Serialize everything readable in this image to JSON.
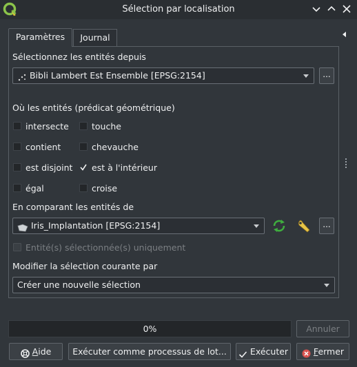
{
  "window": {
    "title": "Sélection par localisation"
  },
  "tabs": [
    {
      "label": "Paramètres",
      "active": true
    },
    {
      "label": "Journal",
      "active": false
    }
  ],
  "source": {
    "label": "Sélectionnez les entités depuis",
    "layer": "Bibli Lambert Est Ensemble [EPSG:2154]",
    "more_label": "..."
  },
  "predicates": {
    "label": "Où les entités (prédicat géométrique)",
    "items": [
      {
        "label": "intersecte",
        "checked": false
      },
      {
        "label": "touche",
        "checked": false
      },
      {
        "label": "contient",
        "checked": false
      },
      {
        "label": "chevauche",
        "checked": false
      },
      {
        "label": "est disjoint",
        "checked": false
      },
      {
        "label": "est à l'intérieur",
        "checked": true
      },
      {
        "label": "égal",
        "checked": false
      },
      {
        "label": "croise",
        "checked": false
      }
    ]
  },
  "compare": {
    "label": "En comparant les entités de",
    "layer": "Iris_Implantation [EPSG:2154]",
    "more_label": "...",
    "selected_only_label": "Entité(s) sélectionnée(s) uniquement"
  },
  "modify": {
    "label": "Modifier la sélection courante par",
    "value": "Créer une nouvelle sélection"
  },
  "progress": {
    "text": "0%",
    "value": 0
  },
  "buttons": {
    "cancel": "Annuler",
    "help_prefix": "",
    "help_ul": "A",
    "help_rest": "ide",
    "batch": "Exécuter comme processus de lot...",
    "run": "Exécuter",
    "close_ul": "F",
    "close_rest": "ermer"
  },
  "colors": {
    "bg": "#31363b",
    "accent_green": "#3fae3f",
    "close_red": "#d9534f"
  }
}
